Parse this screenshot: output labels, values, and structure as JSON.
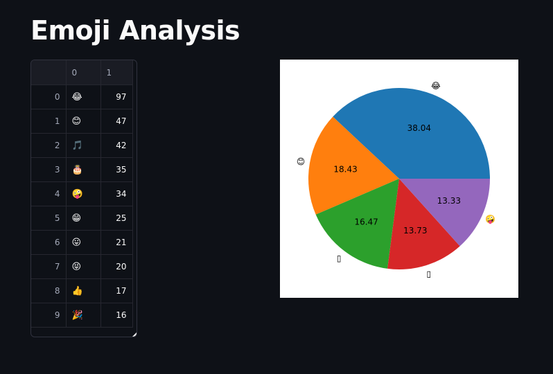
{
  "page": {
    "title": "Emoji Analysis"
  },
  "table": {
    "columns": [
      "",
      "0",
      "1"
    ],
    "rows": [
      {
        "index": "0",
        "emoji": "😂",
        "count": "97"
      },
      {
        "index": "1",
        "emoji": "😊",
        "count": "47"
      },
      {
        "index": "2",
        "emoji": "🎵",
        "count": "42"
      },
      {
        "index": "3",
        "emoji": "🎂",
        "count": "35"
      },
      {
        "index": "4",
        "emoji": "🤪",
        "count": "34"
      },
      {
        "index": "5",
        "emoji": "😁",
        "count": "25"
      },
      {
        "index": "6",
        "emoji": "😛",
        "count": "21"
      },
      {
        "index": "7",
        "emoji": "😝",
        "count": "20"
      },
      {
        "index": "8",
        "emoji": "👍",
        "count": "17"
      },
      {
        "index": "9",
        "emoji": "🎉",
        "count": "16"
      }
    ]
  },
  "chart_data": {
    "type": "pie",
    "categories": [
      "😂",
      "😊",
      "🎵",
      "🎂",
      "🤪"
    ],
    "category_labels_shown": [
      "😂",
      "😊",
      "▯",
      "▯",
      "🤪"
    ],
    "values": [
      97,
      47,
      42,
      35,
      34
    ],
    "labels": [
      "38.04",
      "18.43",
      "16.47",
      "13.73",
      "13.33"
    ],
    "colors": [
      "#1f77b4",
      "#ff7f0e",
      "#2ca02c",
      "#d62728",
      "#9467bd"
    ],
    "title": "",
    "start_angle_deg": 0,
    "direction": "counterclockwise"
  }
}
